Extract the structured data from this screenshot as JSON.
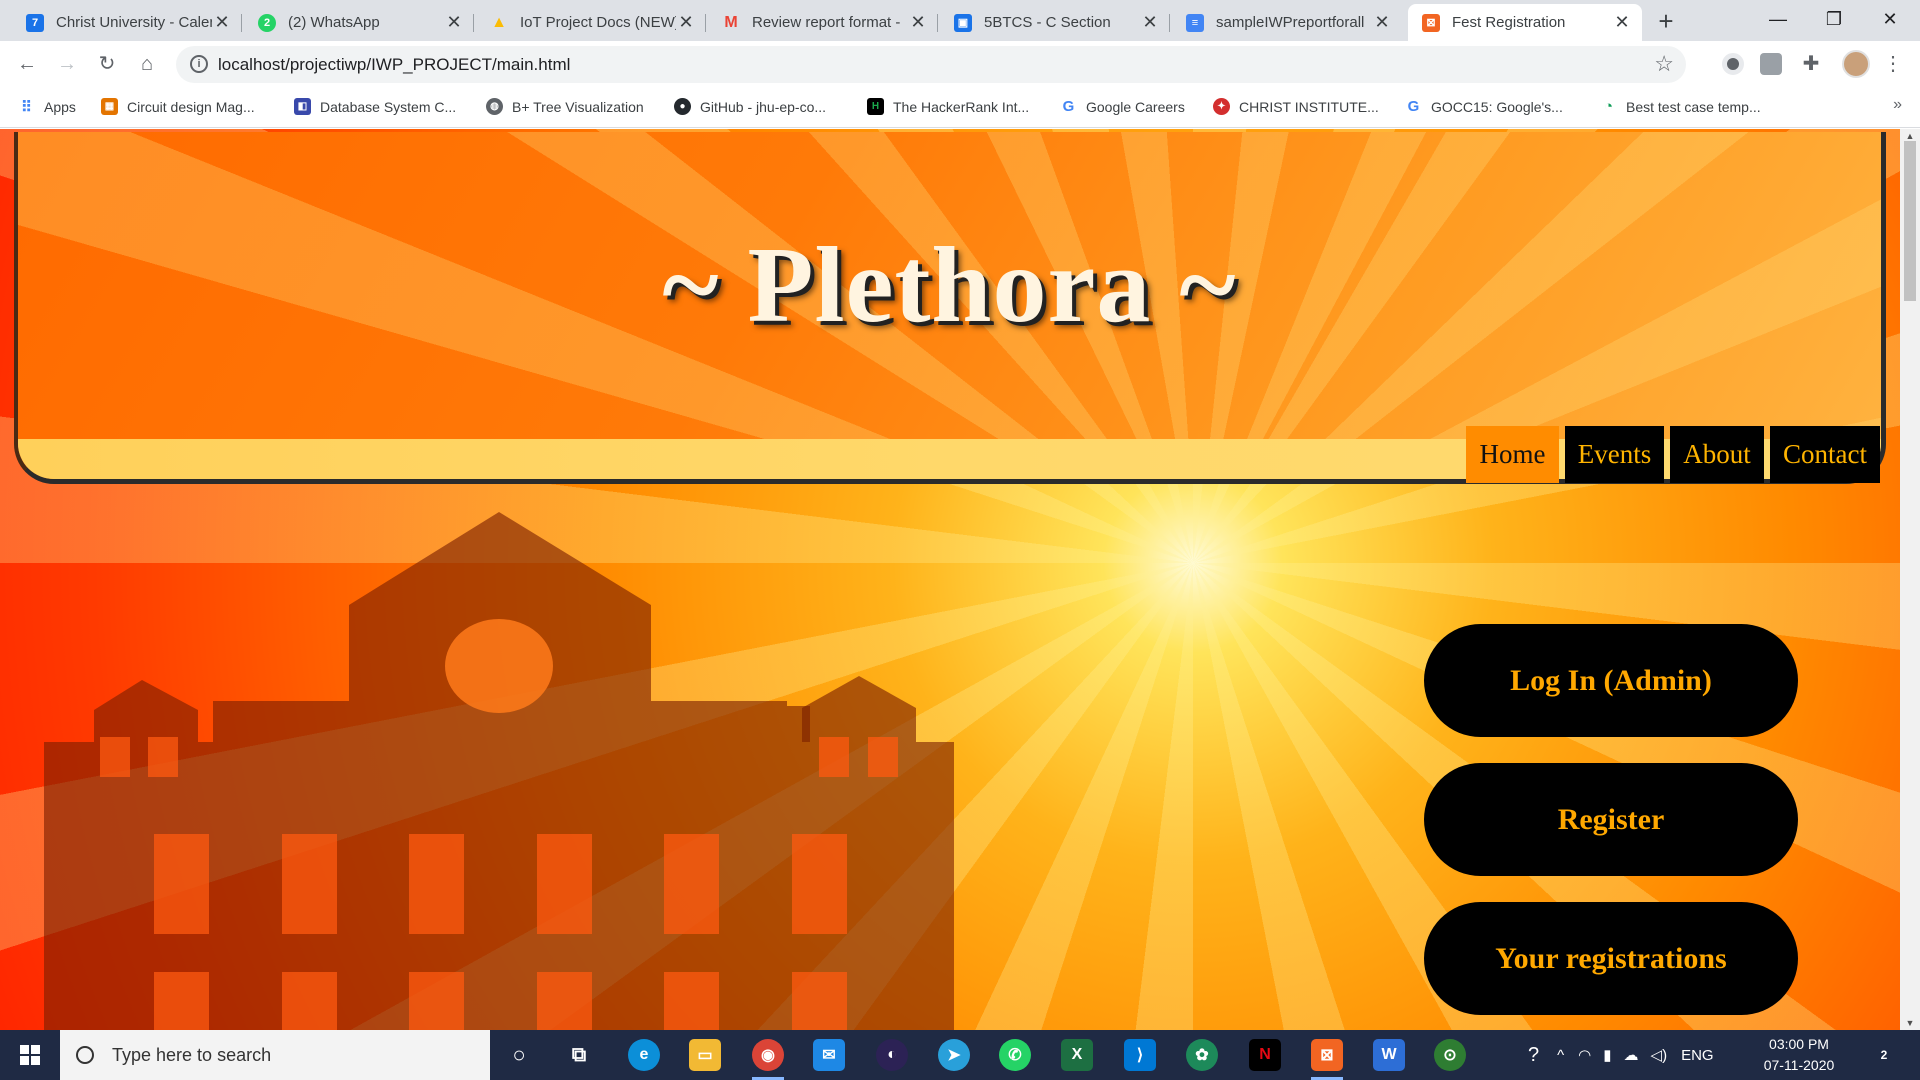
{
  "browser": {
    "tabs": [
      {
        "title": "Christ University - Calen",
        "fav_color": "#1a73e8",
        "fav_glyph": "7",
        "icon": "calendar-icon"
      },
      {
        "title": "(2) WhatsApp",
        "fav_color": "#25d366",
        "fav_glyph": "2",
        "icon": "whatsapp-icon"
      },
      {
        "title": "IoT Project Docs (NEW)",
        "fav_color": "#fbbc04",
        "fav_glyph": "▲",
        "icon": "drive-icon"
      },
      {
        "title": "Review report format -",
        "fav_color": "#ea4335",
        "fav_glyph": "M",
        "icon": "gmail-icon"
      },
      {
        "title": "5BTCS - C Section",
        "fav_color": "#1a73e8",
        "fav_glyph": "▣",
        "icon": "contacts-icon"
      },
      {
        "title": "sampleIWPreportforall",
        "fav_color": "#4285f4",
        "fav_glyph": "≡",
        "icon": "docs-icon"
      },
      {
        "title": "Fest Registration",
        "fav_color": "#f26522",
        "fav_glyph": "⊠",
        "icon": "xampp-icon",
        "active": true
      }
    ],
    "url": "localhost/projectiwp/IWP_PROJECT/main.html",
    "bookmarks": [
      {
        "label": "Apps",
        "color": "#4285f4",
        "icon": "apps-grid-icon"
      },
      {
        "label": "Circuit design Mag...",
        "color": "#e37400",
        "icon": "circuit-icon"
      },
      {
        "label": "Database System C...",
        "color": "#3949ab",
        "icon": "database-icon"
      },
      {
        "label": "B+ Tree Visualization",
        "color": "#5f6368",
        "icon": "globe-icon"
      },
      {
        "label": "GitHub - jhu-ep-co...",
        "color": "#24292e",
        "icon": "github-icon"
      },
      {
        "label": "The HackerRank Int...",
        "color": "#1ba94c",
        "icon": "hackerrank-icon"
      },
      {
        "label": "Google Careers",
        "color": "#4285f4",
        "icon": "google-icon"
      },
      {
        "label": "CHRIST INSTITUTE...",
        "color": "#d32f2f",
        "icon": "christ-icon"
      },
      {
        "label": "GOCC15: Google's...",
        "color": "#4285f4",
        "icon": "google-icon"
      },
      {
        "label": "Best test case temp...",
        "color": "#0f9d58",
        "icon": "testcase-icon"
      }
    ]
  },
  "page": {
    "title": "~ Plethora ~",
    "nav": [
      {
        "label": "Home",
        "active": true
      },
      {
        "label": "Events"
      },
      {
        "label": "About"
      },
      {
        "label": "Contact"
      }
    ],
    "buttons": {
      "login": "Log In (Admin)",
      "register": "Register",
      "registrations": "Your registrations"
    },
    "colors": {
      "accent": "#ffa800",
      "nav_active": "#ff8c00",
      "button_bg": "#000000"
    }
  },
  "taskbar": {
    "search_placeholder": "Type here to search",
    "language": "ENG",
    "time": "03:00 PM",
    "date": "07-11-2020",
    "notification_count": "2"
  }
}
